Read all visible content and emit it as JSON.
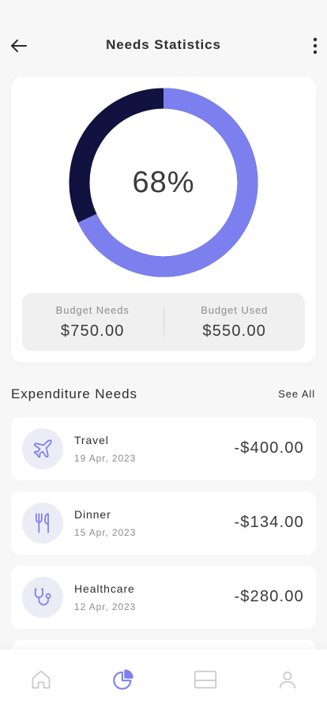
{
  "header": {
    "title": "Needs Statistics",
    "back_icon": "arrow-left-icon",
    "more_icon": "vertical-ellipsis-icon"
  },
  "stats": {
    "percent": 68,
    "percent_label": "68%",
    "used_color": "#7b80ee",
    "remaining_color": "#11123f",
    "budget_needs_label": "Budget Needs",
    "budget_needs_value": "$750.00",
    "budget_used_label": "Budget Used",
    "budget_used_value": "$550.00"
  },
  "expenditure": {
    "title": "Expenditure Needs",
    "see_all": "See All",
    "items": [
      {
        "name": "Travel",
        "date": "19 Apr, 2023",
        "amount": "-$400.00",
        "icon": "airplane-icon"
      },
      {
        "name": "Dinner",
        "date": "15 Apr, 2023",
        "amount": "-$134.00",
        "icon": "fork-knife-icon"
      },
      {
        "name": "Healthcare",
        "date": "12 Apr, 2023",
        "amount": "-$280.00",
        "icon": "stethoscope-icon"
      }
    ]
  },
  "nav": {
    "items": [
      {
        "icon": "home-icon",
        "active": false
      },
      {
        "icon": "pie-chart-icon",
        "active": true
      },
      {
        "icon": "card-icon",
        "active": false
      },
      {
        "icon": "profile-icon",
        "active": false
      }
    ],
    "active_color": "#7b80ee",
    "inactive_color": "#c9c9ce"
  }
}
